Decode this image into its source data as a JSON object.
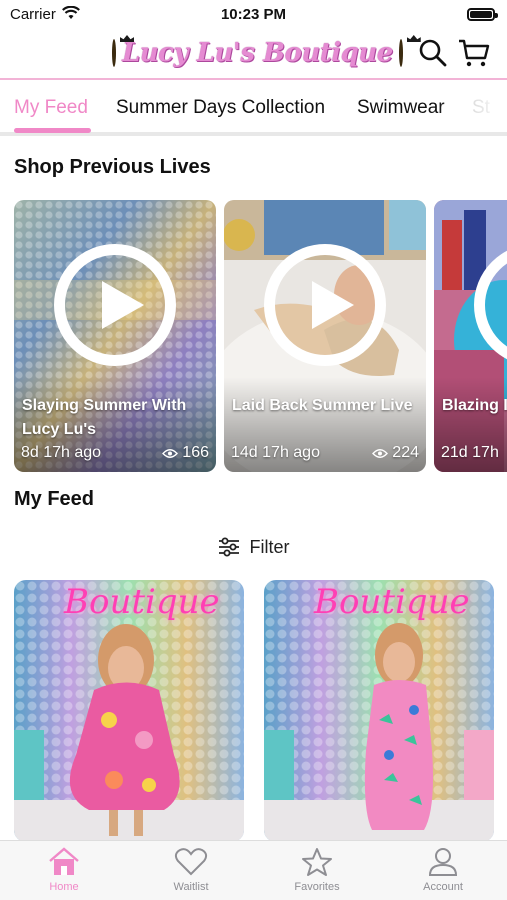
{
  "status_bar": {
    "carrier": "Carrier",
    "time": "10:23 PM"
  },
  "header": {
    "logo_text": "Lucy Lu's Boutique"
  },
  "tabs": [
    {
      "label": "My Feed",
      "active": true
    },
    {
      "label": "Summer Days Collection",
      "active": false
    },
    {
      "label": "Swimwear",
      "active": false
    },
    {
      "label": "St",
      "active": false
    }
  ],
  "sections": {
    "previous_lives": "Shop Previous Lives",
    "my_feed": "My Feed"
  },
  "lives": [
    {
      "title": "Slaying Summer With Lucy Lu's",
      "age": "8d 17h ago",
      "views": "166"
    },
    {
      "title": "Laid Back Summer Live",
      "age": "14d 17h ago",
      "views": "224"
    },
    {
      "title": "Blazing I Summer",
      "age": "21d 17h",
      "views": ""
    }
  ],
  "filter": {
    "label": "Filter"
  },
  "bottom_nav": [
    {
      "label": "Home",
      "icon": "home-icon",
      "active": true
    },
    {
      "label": "Waitlist",
      "icon": "heart-icon",
      "active": false
    },
    {
      "label": "Favorites",
      "icon": "star-icon",
      "active": false
    },
    {
      "label": "Account",
      "icon": "person-icon",
      "active": false
    }
  ],
  "colors": {
    "accent": "#f088c7",
    "logo": "#e58bd2",
    "divider": "#f2b3d6"
  },
  "feed_neon_sign": "Boutique"
}
